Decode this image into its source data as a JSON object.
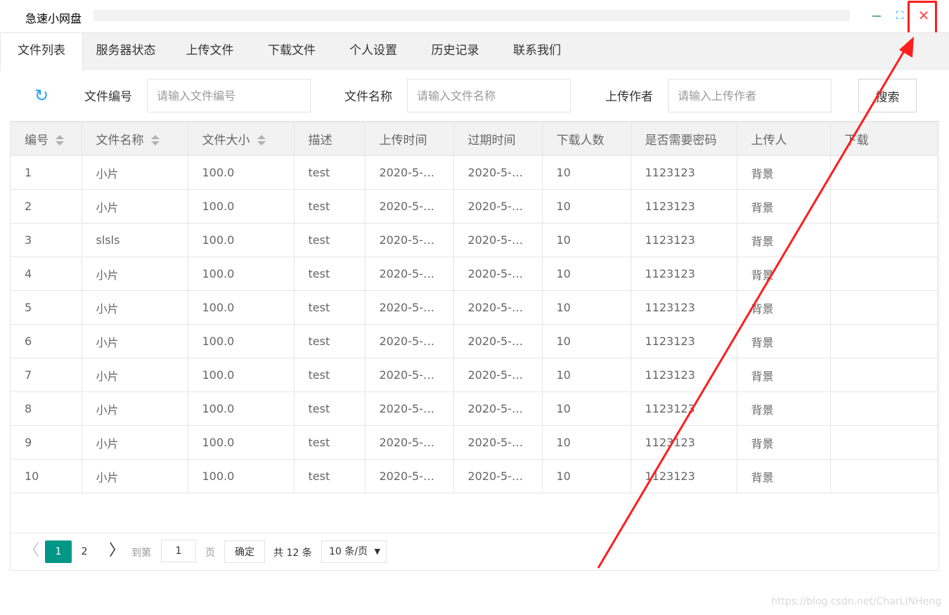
{
  "window": {
    "title": "急速小网盘",
    "minimize_icon": "minimize-icon",
    "maximize_icon": "maximize-icon",
    "maximize_glyph": "⛶",
    "close_icon": "close-icon",
    "close_glyph": "✕"
  },
  "tabs": [
    {
      "label": "文件列表",
      "active": true
    },
    {
      "label": "服务器状态",
      "active": false
    },
    {
      "label": "上传文件",
      "active": false
    },
    {
      "label": "下载文件",
      "active": false
    },
    {
      "label": "个人设置",
      "active": false
    },
    {
      "label": "历史记录",
      "active": false
    },
    {
      "label": "联系我们",
      "active": false
    }
  ],
  "search": {
    "refresh_icon": "refresh-icon",
    "refresh_glyph": "↻",
    "file_id_label": "文件编号",
    "file_id_placeholder": "请输入文件编号",
    "file_name_label": "文件名称",
    "file_name_placeholder": "请输入文件名称",
    "author_label": "上传作者",
    "author_placeholder": "请输入上传作者",
    "search_button": "搜索"
  },
  "table": {
    "headers": [
      "编号",
      "文件名称",
      "文件大小",
      "描述",
      "上传时间",
      "过期时间",
      "下载人数",
      "是否需要密码",
      "上传人",
      "下载"
    ],
    "rows": [
      [
        "1",
        "小片",
        "100.0",
        "test",
        "2020-5-…",
        "2020-5-…",
        "10",
        "1123123",
        "背景",
        ""
      ],
      [
        "2",
        "小片",
        "100.0",
        "test",
        "2020-5-…",
        "2020-5-…",
        "10",
        "1123123",
        "背景",
        ""
      ],
      [
        "3",
        "slsls",
        "100.0",
        "test",
        "2020-5-…",
        "2020-5-…",
        "10",
        "1123123",
        "背景",
        ""
      ],
      [
        "4",
        "小片",
        "100.0",
        "test",
        "2020-5-…",
        "2020-5-…",
        "10",
        "1123123",
        "背景",
        ""
      ],
      [
        "5",
        "小片",
        "100.0",
        "test",
        "2020-5-…",
        "2020-5-…",
        "10",
        "1123123",
        "背景",
        ""
      ],
      [
        "6",
        "小片",
        "100.0",
        "test",
        "2020-5-…",
        "2020-5-…",
        "10",
        "1123123",
        "背景",
        ""
      ],
      [
        "7",
        "小片",
        "100.0",
        "test",
        "2020-5-…",
        "2020-5-…",
        "10",
        "1123123",
        "背景",
        ""
      ],
      [
        "8",
        "小片",
        "100.0",
        "test",
        "2020-5-…",
        "2020-5-…",
        "10",
        "1123123",
        "背景",
        ""
      ],
      [
        "9",
        "小片",
        "100.0",
        "test",
        "2020-5-…",
        "2020-5-…",
        "10",
        "1123123",
        "背景",
        ""
      ],
      [
        "10",
        "小片",
        "100.0",
        "test",
        "2020-5-…",
        "2020-5-…",
        "10",
        "1123123",
        "背景",
        ""
      ]
    ]
  },
  "pagination": {
    "prev_icon": "chevron-left-icon",
    "prev_glyph": "〈",
    "pages": [
      "1",
      "2"
    ],
    "current_page": "1",
    "next_icon": "chevron-right-icon",
    "next_glyph": "〉",
    "goto_label": "到第",
    "goto_value": "1",
    "page_unit": "页",
    "confirm_button": "确定",
    "total_text": "共 12 条",
    "page_size": "10 条/页",
    "page_size_arrow": "▼"
  },
  "watermark": "https://blog.csdn.net/CharLINHeng",
  "colors": {
    "accent": "#009688",
    "annotation": "#ff1d1d",
    "close": "#ff4c4c",
    "refresh": "#1e9fff"
  }
}
